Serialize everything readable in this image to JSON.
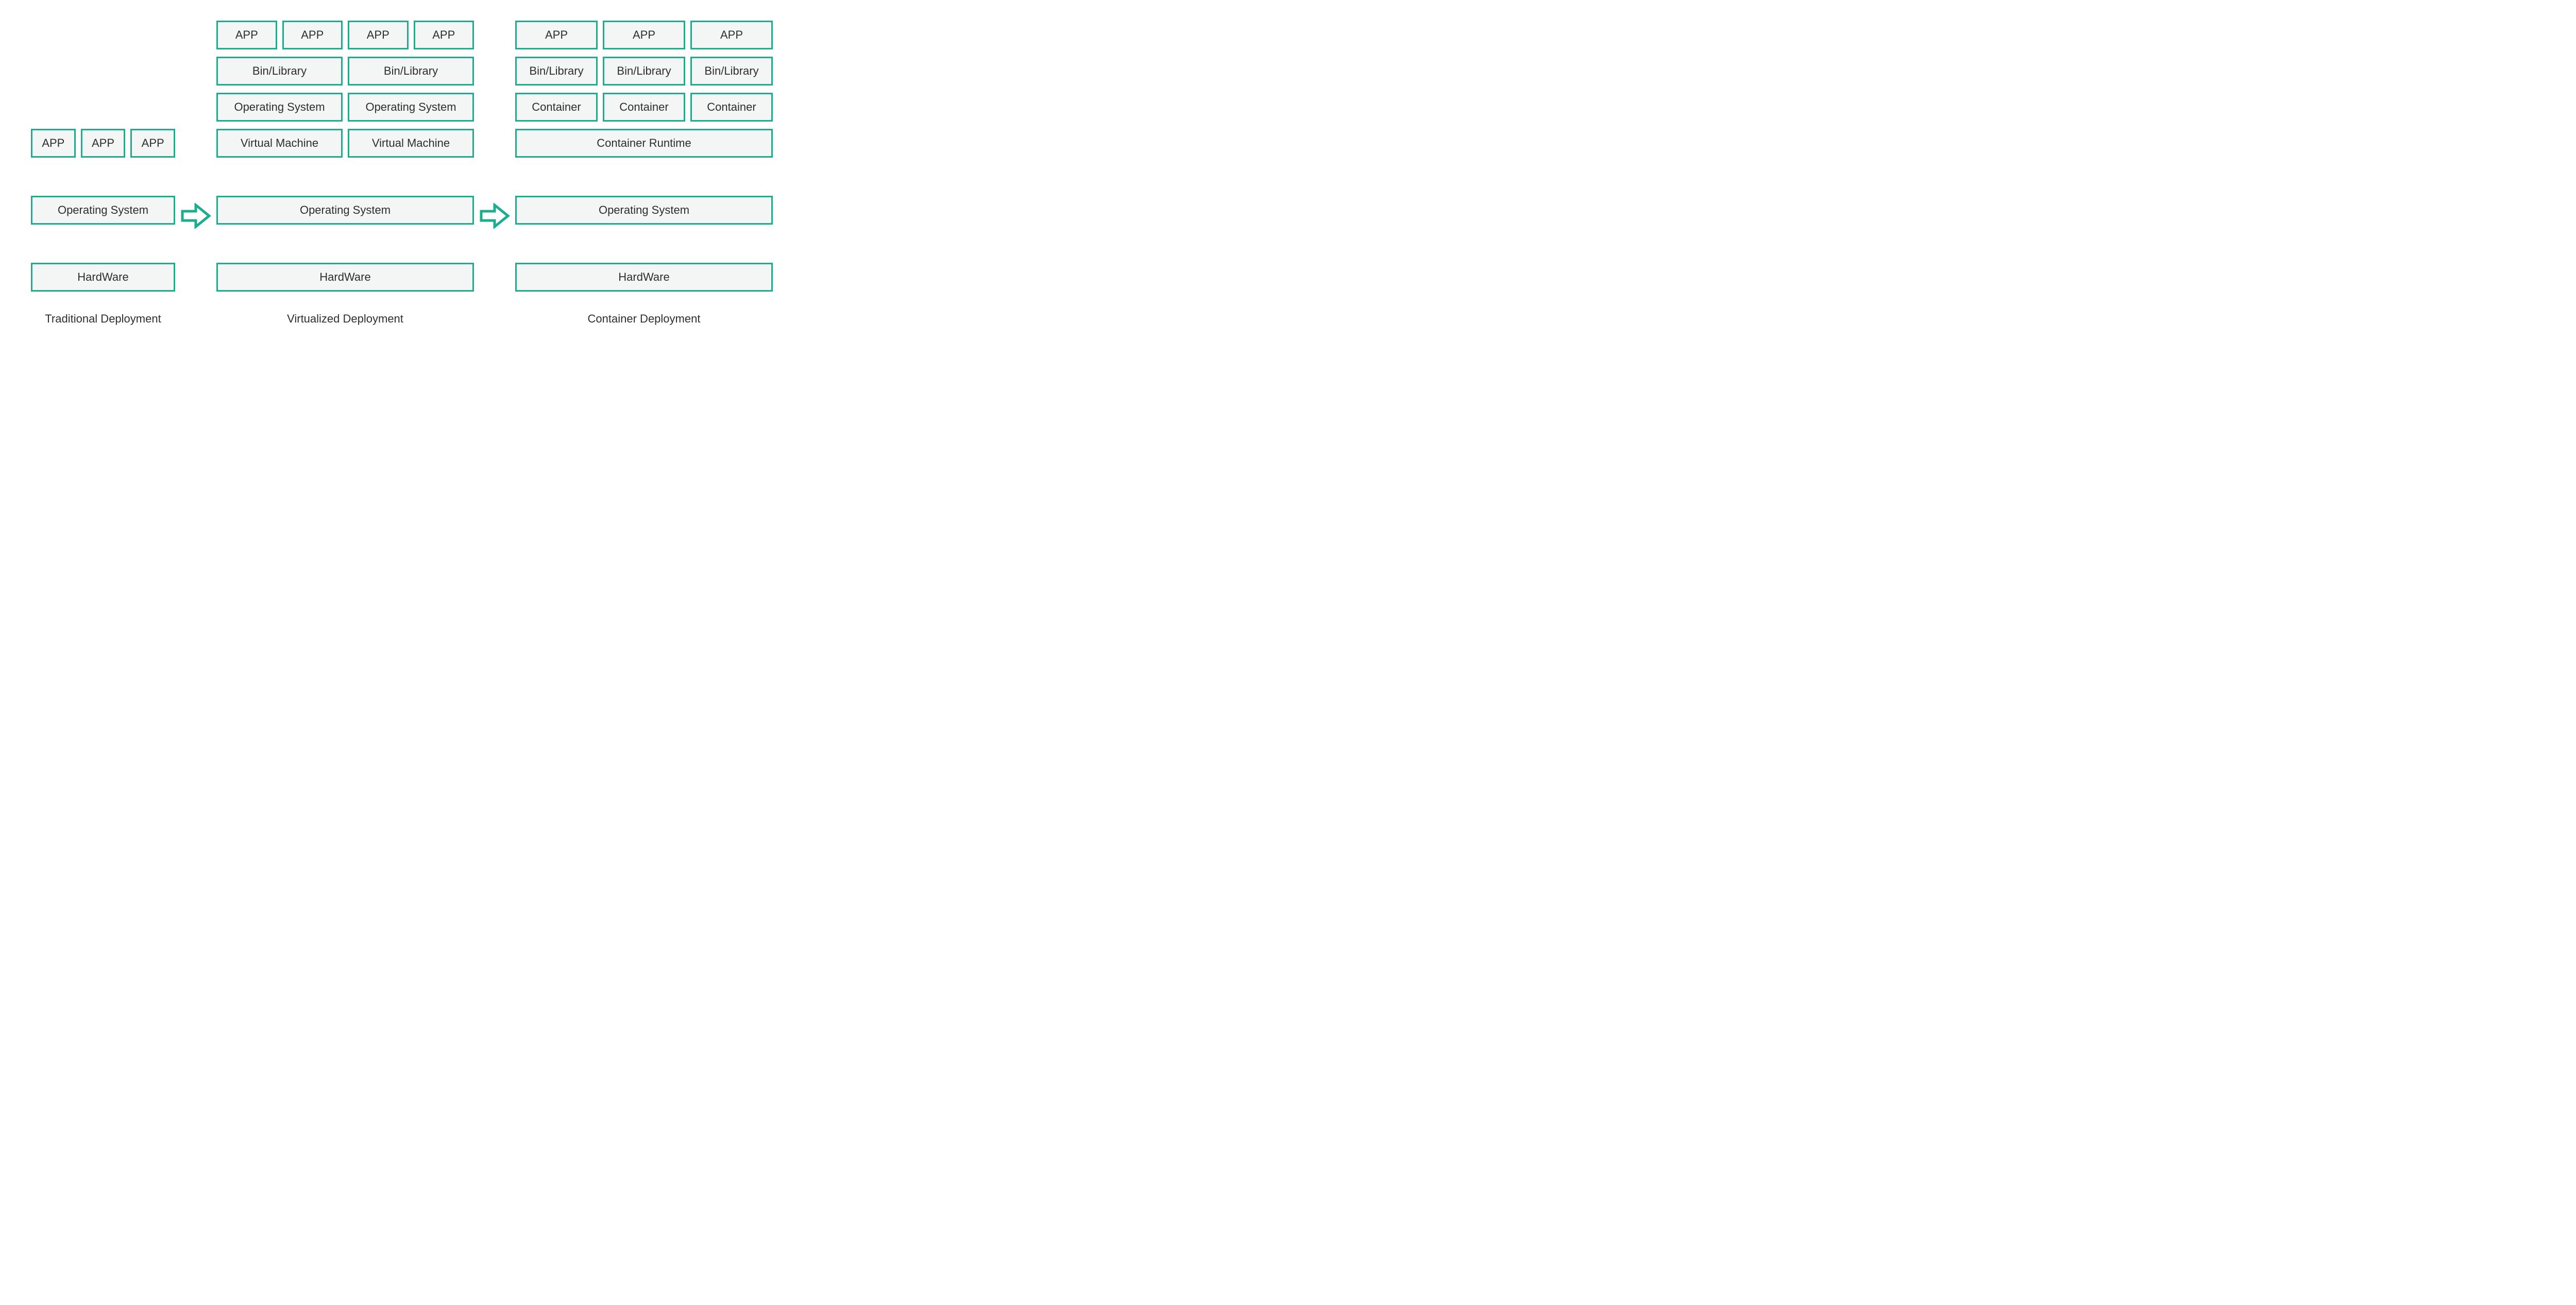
{
  "colors": {
    "accent": "#1aae8e",
    "box_fill": "#f4f6f6",
    "text": "#2e2e2e"
  },
  "labels": {
    "app": "APP",
    "bin": "Bin/Library",
    "os_guest": "Operating System",
    "vm": "Virtual Machine",
    "container": "Container",
    "runtime": "Container Runtime",
    "os": "Operating System",
    "hw": "HardWare"
  },
  "captions": {
    "traditional": "Traditional Deployment",
    "virtualized": "Virtualized Deployment",
    "container": "Container Deployment"
  }
}
